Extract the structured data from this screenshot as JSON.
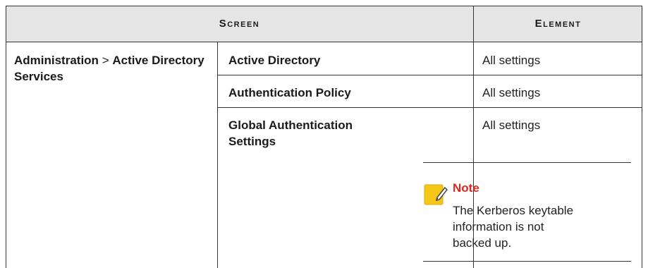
{
  "table": {
    "headers": {
      "screen": "Screen",
      "element": "Element"
    },
    "section": {
      "part1": "Administration",
      "separator": ">",
      "part2": "Active Directory Services"
    },
    "rows": [
      {
        "screen": "Active Directory",
        "element": "All settings"
      },
      {
        "screen": "Authentication Policy",
        "element": "All settings"
      },
      {
        "screen": "Global Authentication Settings",
        "element": "All settings"
      }
    ],
    "note": {
      "icon": "note-pencil-icon",
      "title": "Note",
      "text": "The Kerberos keytable information is not backed up.",
      "title_color": "#e8231e",
      "icon_color": "#f5c518"
    }
  }
}
